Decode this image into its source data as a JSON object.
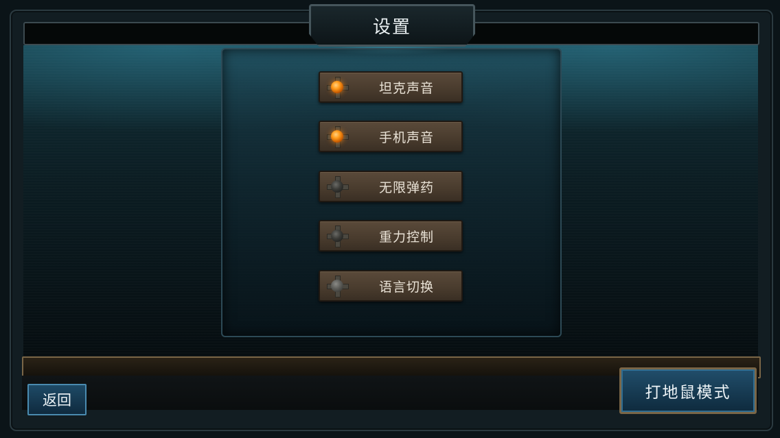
{
  "title": "设置",
  "options": [
    {
      "label": "坦克声音",
      "state": "on"
    },
    {
      "label": "手机声音",
      "state": "on"
    },
    {
      "label": "无限弹药",
      "state": "off"
    },
    {
      "label": "重力控制",
      "state": "off"
    },
    {
      "label": "语言切换",
      "state": "neutral"
    }
  ],
  "buttons": {
    "back": "返回",
    "mode": "打地鼠模式"
  },
  "colors": {
    "accent_on": "#ff9a1a",
    "option_bg": "#4a3c2e",
    "button_blue": "#1e4a66",
    "frame_gold": "#7a6647"
  },
  "icons": {
    "toggle_on": "orange-orb-icon",
    "toggle_off": "dark-orb-icon"
  }
}
